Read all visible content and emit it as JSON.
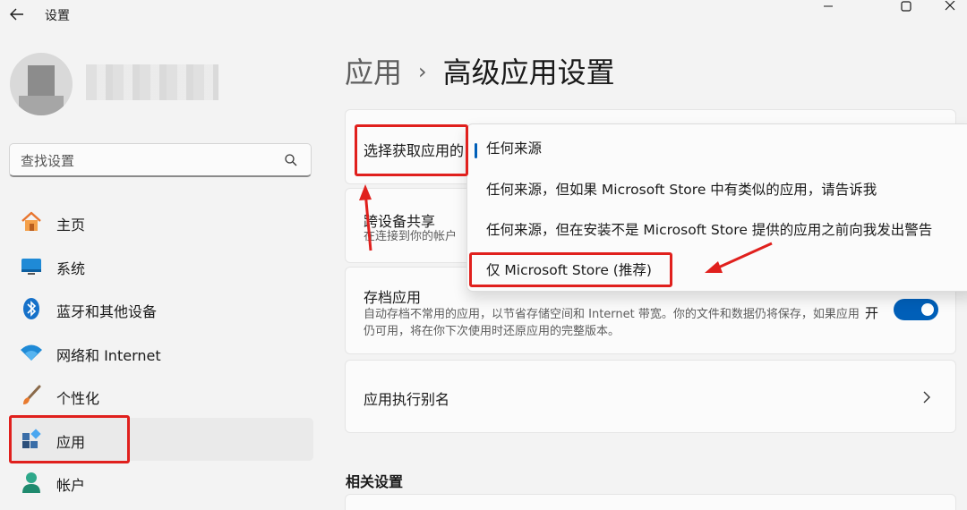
{
  "window": {
    "title": "设置"
  },
  "sidebar": {
    "search_placeholder": "查找设置",
    "items": [
      {
        "label": "主页",
        "icon": "home-icon"
      },
      {
        "label": "系统",
        "icon": "monitor-icon"
      },
      {
        "label": "蓝牙和其他设备",
        "icon": "bluetooth-icon"
      },
      {
        "label": "网络和 Internet",
        "icon": "wifi-icon"
      },
      {
        "label": "个性化",
        "icon": "brush-icon"
      },
      {
        "label": "应用",
        "icon": "apps-icon",
        "active": true
      },
      {
        "label": "帐户",
        "icon": "person-icon"
      }
    ]
  },
  "breadcrumb": {
    "parent": "应用",
    "separator": "›",
    "current": "高级应用设置"
  },
  "main": {
    "choose_source": {
      "title": "选择获取应用的"
    },
    "cross_device": {
      "title": "跨设备共享",
      "desc": "在连接到你的帐户"
    },
    "archive": {
      "title": "存档应用",
      "desc": "自动存档不常用的应用，以节省存储空间和 Internet 带宽。你的文件和数据仍将保存，如果应用仍可用，将在你下次使用时还原应用的完整版本。",
      "toggle_label": "开",
      "toggle_on": true
    },
    "aliases": {
      "title": "应用执行别名"
    },
    "related_title": "相关设置"
  },
  "dropdown": {
    "options": [
      "任何来源",
      "任何来源，但如果 Microsoft Store 中有类似的应用，请告诉我",
      "任何来源，但在安装不是 Microsoft Store 提供的应用之前向我发出警告",
      "仅 Microsoft Store (推荐)"
    ],
    "selected_index": 0
  },
  "colors": {
    "accent": "#005fb8",
    "annotation": "#e0201d",
    "background": "#f3f3f3",
    "card": "#fbfbfb"
  }
}
